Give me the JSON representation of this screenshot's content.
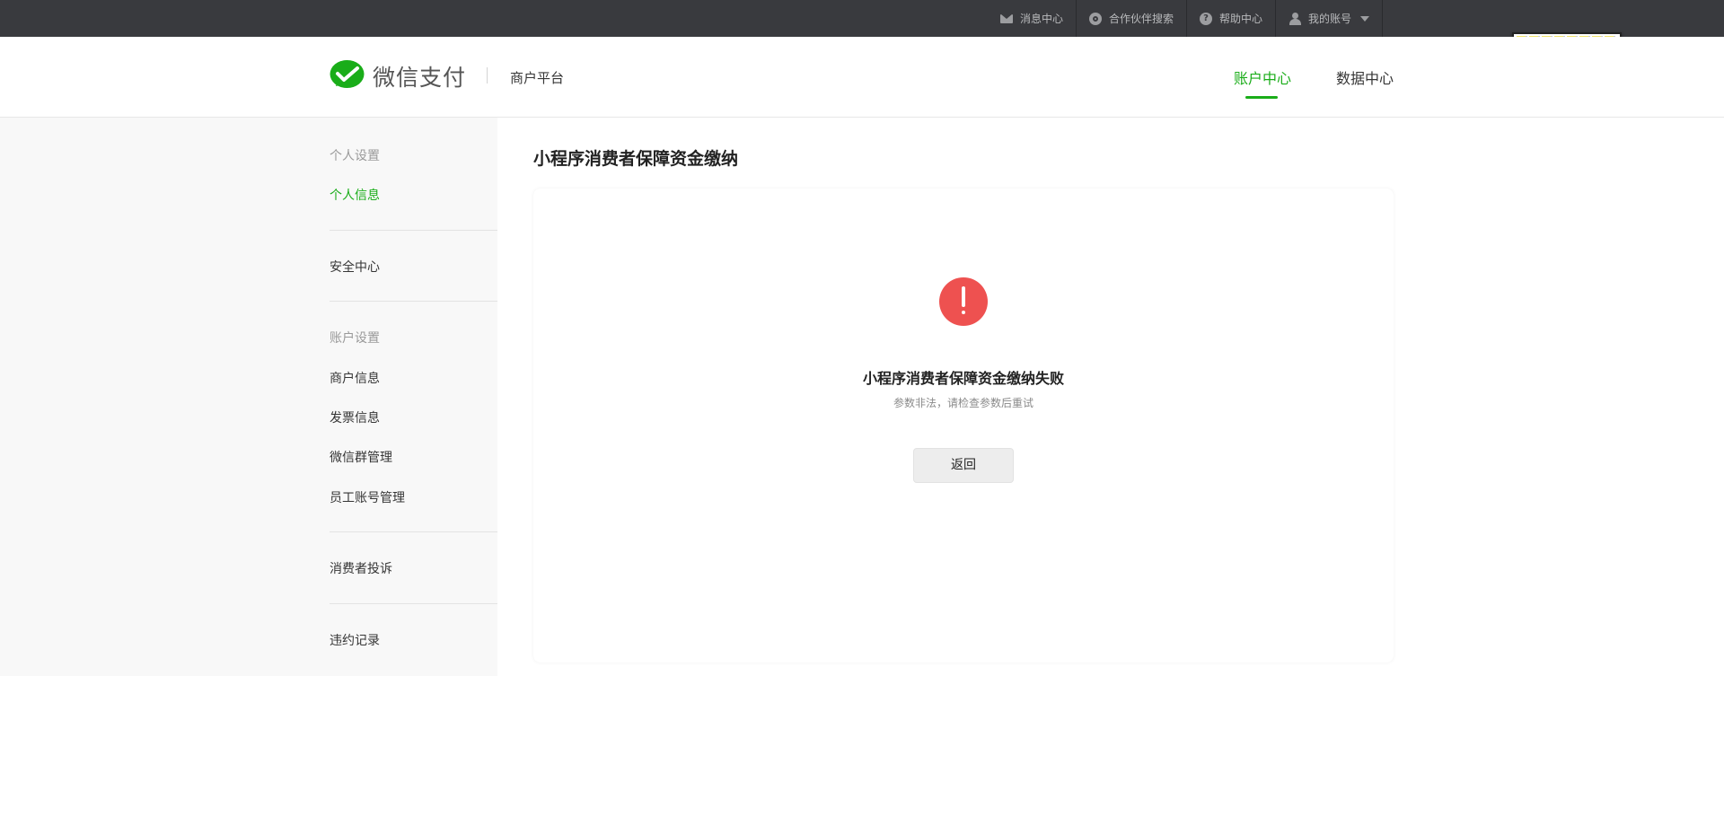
{
  "topbar": {
    "items": [
      {
        "label": "消息中心",
        "icon": "mail-icon"
      },
      {
        "label": "合作伙伴搜索",
        "icon": "partner-search-icon"
      },
      {
        "label": "帮助中心",
        "icon": "help-icon"
      },
      {
        "label": "我的账号",
        "icon": "user-icon"
      }
    ]
  },
  "header": {
    "brand": "微信支付",
    "platform": "商户平台",
    "nav": [
      {
        "label": "账户中心",
        "active": true
      },
      {
        "label": "数据中心",
        "active": false
      }
    ]
  },
  "sidebar": {
    "personal_title": "个人设置",
    "personal_info": "个人信息",
    "security_center": "安全中心",
    "account_title": "账户设置",
    "merchant_info": "商户信息",
    "invoice_info": "发票信息",
    "wechat_group": "微信群管理",
    "staff_account": "员工账号管理",
    "consumer_complaint": "消费者投诉",
    "violation_record": "违约记录"
  },
  "main": {
    "page_title": "小程序消费者保障资金缴纳",
    "result_title": "小程序消费者保障资金缴纳失败",
    "result_desc": "参数非法，请检查参数后重试",
    "back_label": "返回"
  },
  "colors": {
    "accent": "#1aad19",
    "error": "#ee5150",
    "topbar": "#393a3e"
  }
}
